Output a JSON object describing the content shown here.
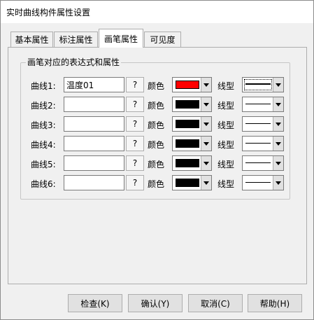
{
  "window": {
    "title": "实时曲线构件属性设置"
  },
  "tabs": [
    {
      "label": "基本属性",
      "active": false
    },
    {
      "label": "标注属性",
      "active": false
    },
    {
      "label": "画笔属性",
      "active": true
    },
    {
      "label": "可见度",
      "active": false
    }
  ],
  "group": {
    "title": "画笔对应的表达式和属性"
  },
  "labels": {
    "color": "颜色",
    "line_style": "线型",
    "browse": "?"
  },
  "curves": [
    {
      "label": "曲线1:",
      "expression": "温度01",
      "color": "#ff0000",
      "line": "thick"
    },
    {
      "label": "曲线2:",
      "expression": "",
      "color": "#000000",
      "line": "thin"
    },
    {
      "label": "曲线3:",
      "expression": "",
      "color": "#000000",
      "line": "thin"
    },
    {
      "label": "曲线4:",
      "expression": "",
      "color": "#000000",
      "line": "thin"
    },
    {
      "label": "曲线5:",
      "expression": "",
      "color": "#000000",
      "line": "thin"
    },
    {
      "label": "曲线6:",
      "expression": "",
      "color": "#000000",
      "line": "thin"
    }
  ],
  "buttons": {
    "check": "检查(K)",
    "ok": "确认(Y)",
    "cancel": "取消(C)",
    "help": "帮助(H)"
  }
}
